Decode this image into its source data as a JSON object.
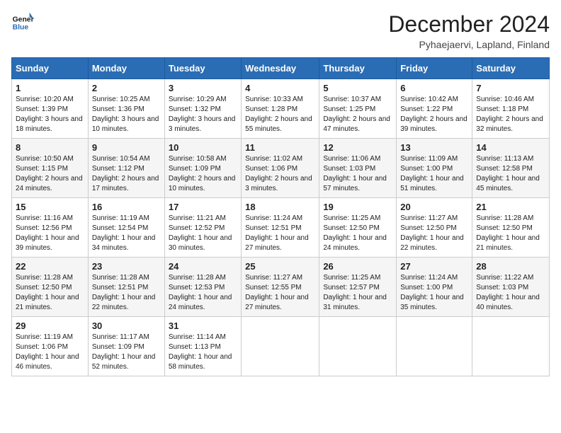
{
  "logo": {
    "line1": "General",
    "line2": "Blue"
  },
  "title": "December 2024",
  "subtitle": "Pyhaejaervi, Lapland, Finland",
  "days_of_week": [
    "Sunday",
    "Monday",
    "Tuesday",
    "Wednesday",
    "Thursday",
    "Friday",
    "Saturday"
  ],
  "weeks": [
    [
      {
        "day": "1",
        "info": "Sunrise: 10:20 AM\nSunset: 1:39 PM\nDaylight: 3 hours and 18 minutes."
      },
      {
        "day": "2",
        "info": "Sunrise: 10:25 AM\nSunset: 1:36 PM\nDaylight: 3 hours and 10 minutes."
      },
      {
        "day": "3",
        "info": "Sunrise: 10:29 AM\nSunset: 1:32 PM\nDaylight: 3 hours and 3 minutes."
      },
      {
        "day": "4",
        "info": "Sunrise: 10:33 AM\nSunset: 1:28 PM\nDaylight: 2 hours and 55 minutes."
      },
      {
        "day": "5",
        "info": "Sunrise: 10:37 AM\nSunset: 1:25 PM\nDaylight: 2 hours and 47 minutes."
      },
      {
        "day": "6",
        "info": "Sunrise: 10:42 AM\nSunset: 1:22 PM\nDaylight: 2 hours and 39 minutes."
      },
      {
        "day": "7",
        "info": "Sunrise: 10:46 AM\nSunset: 1:18 PM\nDaylight: 2 hours and 32 minutes."
      }
    ],
    [
      {
        "day": "8",
        "info": "Sunrise: 10:50 AM\nSunset: 1:15 PM\nDaylight: 2 hours and 24 minutes."
      },
      {
        "day": "9",
        "info": "Sunrise: 10:54 AM\nSunset: 1:12 PM\nDaylight: 2 hours and 17 minutes."
      },
      {
        "day": "10",
        "info": "Sunrise: 10:58 AM\nSunset: 1:09 PM\nDaylight: 2 hours and 10 minutes."
      },
      {
        "day": "11",
        "info": "Sunrise: 11:02 AM\nSunset: 1:06 PM\nDaylight: 2 hours and 3 minutes."
      },
      {
        "day": "12",
        "info": "Sunrise: 11:06 AM\nSunset: 1:03 PM\nDaylight: 1 hour and 57 minutes."
      },
      {
        "day": "13",
        "info": "Sunrise: 11:09 AM\nSunset: 1:00 PM\nDaylight: 1 hour and 51 minutes."
      },
      {
        "day": "14",
        "info": "Sunrise: 11:13 AM\nSunset: 12:58 PM\nDaylight: 1 hour and 45 minutes."
      }
    ],
    [
      {
        "day": "15",
        "info": "Sunrise: 11:16 AM\nSunset: 12:56 PM\nDaylight: 1 hour and 39 minutes."
      },
      {
        "day": "16",
        "info": "Sunrise: 11:19 AM\nSunset: 12:54 PM\nDaylight: 1 hour and 34 minutes."
      },
      {
        "day": "17",
        "info": "Sunrise: 11:21 AM\nSunset: 12:52 PM\nDaylight: 1 hour and 30 minutes."
      },
      {
        "day": "18",
        "info": "Sunrise: 11:24 AM\nSunset: 12:51 PM\nDaylight: 1 hour and 27 minutes."
      },
      {
        "day": "19",
        "info": "Sunrise: 11:25 AM\nSunset: 12:50 PM\nDaylight: 1 hour and 24 minutes."
      },
      {
        "day": "20",
        "info": "Sunrise: 11:27 AM\nSunset: 12:50 PM\nDaylight: 1 hour and 22 minutes."
      },
      {
        "day": "21",
        "info": "Sunrise: 11:28 AM\nSunset: 12:50 PM\nDaylight: 1 hour and 21 minutes."
      }
    ],
    [
      {
        "day": "22",
        "info": "Sunrise: 11:28 AM\nSunset: 12:50 PM\nDaylight: 1 hour and 21 minutes."
      },
      {
        "day": "23",
        "info": "Sunrise: 11:28 AM\nSunset: 12:51 PM\nDaylight: 1 hour and 22 minutes."
      },
      {
        "day": "24",
        "info": "Sunrise: 11:28 AM\nSunset: 12:53 PM\nDaylight: 1 hour and 24 minutes."
      },
      {
        "day": "25",
        "info": "Sunrise: 11:27 AM\nSunset: 12:55 PM\nDaylight: 1 hour and 27 minutes."
      },
      {
        "day": "26",
        "info": "Sunrise: 11:25 AM\nSunset: 12:57 PM\nDaylight: 1 hour and 31 minutes."
      },
      {
        "day": "27",
        "info": "Sunrise: 11:24 AM\nSunset: 1:00 PM\nDaylight: 1 hour and 35 minutes."
      },
      {
        "day": "28",
        "info": "Sunrise: 11:22 AM\nSunset: 1:03 PM\nDaylight: 1 hour and 40 minutes."
      }
    ],
    [
      {
        "day": "29",
        "info": "Sunrise: 11:19 AM\nSunset: 1:06 PM\nDaylight: 1 hour and 46 minutes."
      },
      {
        "day": "30",
        "info": "Sunrise: 11:17 AM\nSunset: 1:09 PM\nDaylight: 1 hour and 52 minutes."
      },
      {
        "day": "31",
        "info": "Sunrise: 11:14 AM\nSunset: 1:13 PM\nDaylight: 1 hour and 58 minutes."
      },
      null,
      null,
      null,
      null
    ]
  ]
}
